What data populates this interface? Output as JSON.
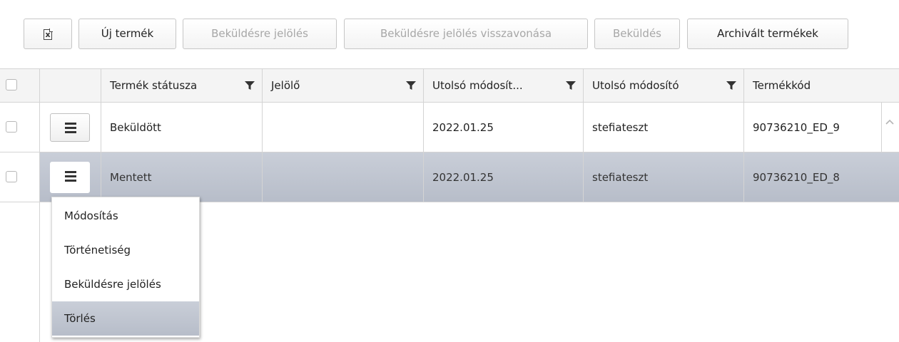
{
  "toolbar": {
    "excel_icon": "excel-export-icon",
    "buttons": [
      {
        "label": "Új termék",
        "disabled": false
      },
      {
        "label": "Beküldésre jelölés",
        "disabled": true
      },
      {
        "label": "Beküldésre jelölés visszavonása",
        "disabled": true
      },
      {
        "label": "Beküldés",
        "disabled": true
      },
      {
        "label": "Archivált termékek",
        "disabled": false
      }
    ]
  },
  "grid": {
    "columns": [
      {
        "label": "Termék státusza",
        "filter": true
      },
      {
        "label": "Jelölő",
        "filter": true
      },
      {
        "label": "Utolsó módosít...",
        "filter": true
      },
      {
        "label": "Utolsó módosító",
        "filter": true
      },
      {
        "label": "Termékkód",
        "filter": false
      }
    ],
    "rows": [
      {
        "status": "Beküldött",
        "marker": "",
        "modified": "2022.01.25",
        "modifier": "stefiateszt",
        "code": "90736210_ED_9",
        "selected": false
      },
      {
        "status": "Mentett",
        "marker": "",
        "modified": "2022.01.25",
        "modifier": "stefiateszt",
        "code": "90736210_ED_8",
        "selected": true
      }
    ]
  },
  "context_menu": {
    "items": [
      {
        "label": "Módosítás"
      },
      {
        "label": "Történetiség"
      },
      {
        "label": "Beküldésre jelölés"
      },
      {
        "label": "Törlés",
        "highlighted": true
      }
    ]
  },
  "colors": {
    "selected_row": "#bdc3ce",
    "disabled_text": "#a7a7a7",
    "border": "#d4d4d4"
  }
}
